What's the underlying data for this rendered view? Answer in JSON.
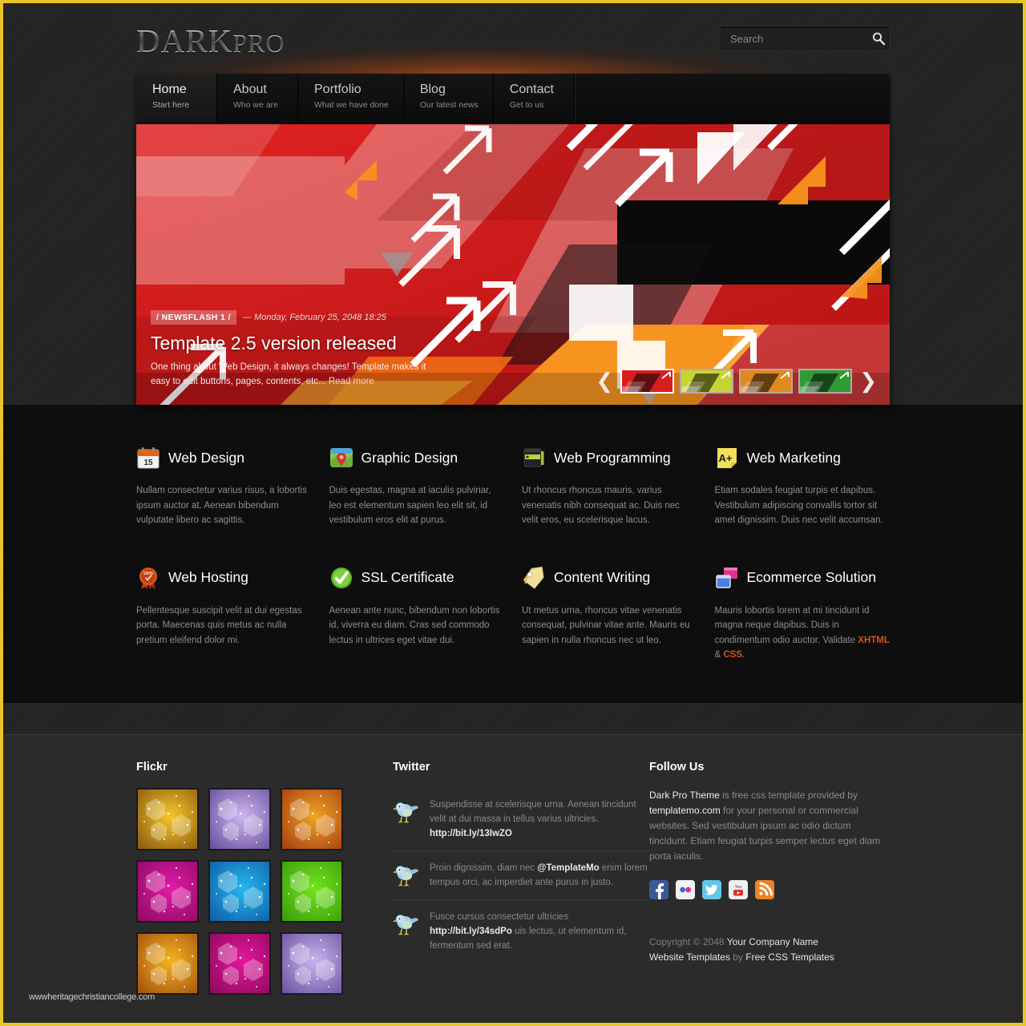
{
  "site": {
    "logo_dark": "DARK",
    "logo_pro": "PRO"
  },
  "search": {
    "placeholder": "Search",
    "value": "",
    "icon": "search-icon"
  },
  "nav": {
    "items": [
      {
        "label": "Home",
        "sub": "Start here",
        "active": true
      },
      {
        "label": "About",
        "sub": "Who we are",
        "active": false
      },
      {
        "label": "Portfolio",
        "sub": "What we have done",
        "active": false
      },
      {
        "label": "Blog",
        "sub": "Our latest news",
        "active": false
      },
      {
        "label": "Contact",
        "sub": "Get to us",
        "active": false
      }
    ]
  },
  "slider": {
    "badge": "/ NEWSFLASH 1 /",
    "date": "— Monday, February 25, 2048 18:25",
    "title": "Template 2.5 version released",
    "desc": "One thing about Web Design, it always changes! Template makes it easy to edit buttons, pages, contents, etc...",
    "read_more": "Read more",
    "prev_icon": "chevron-left-icon",
    "next_icon": "chevron-right-icon",
    "thumbs": [
      {
        "name": "thumb-red",
        "color": "#d81f1f",
        "active": true
      },
      {
        "name": "thumb-yellow",
        "color": "#c6d332",
        "active": false
      },
      {
        "name": "thumb-orange",
        "color": "#e08a1e",
        "active": false
      },
      {
        "name": "thumb-green",
        "color": "#2f9b34",
        "active": false
      }
    ]
  },
  "services": [
    {
      "title": "Web Design",
      "icon": "calendar-icon",
      "text": "Nullam consectetur varius risus, a lobortis ipsum auctor at. Aenean bibendum vulputate libero ac sagittis."
    },
    {
      "title": "Graphic Design",
      "icon": "map-pin-icon",
      "text": "Duis egestas, magna at iaculis pulvinar, leo est elementum sapien leo elit sit, id vestibulum eros elit at purus."
    },
    {
      "title": "Web Programming",
      "icon": "book-icon",
      "text": "Ut rhoncus rhoncus mauris, varius venenatis nibh consequat ac. Duis nec velit eros, eu scelerisque lacus."
    },
    {
      "title": "Web Marketing",
      "icon": "a-plus-note-icon",
      "text": "Etiam sodales feugiat turpis et dapibus. Vestibulum adipiscing convallis tortor sit amet dignissim. Duis nec velit accumsan."
    },
    {
      "title": "Web Hosting",
      "icon": "award-badge-icon",
      "text": "Pellentesque suscipit velit at dui egestas porta. Maecenas quis metus ac nulla pretium eleifend dolor mi."
    },
    {
      "title": "SSL Certificate",
      "icon": "check-circle-icon",
      "text": "Aenean ante nunc, bibendum non lobortis id, viverra eu diam. Cras sed commodo lectus in ultrices eget vitae dui."
    },
    {
      "title": "Content Writing",
      "icon": "tag-icon",
      "text": "Ut metus urna, rhoncus vitae venenatis consequat, pulvinar vitae ante. Mauris eu sapien in nulla rhoncus nec ut leo."
    },
    {
      "title": "Ecommerce Solution",
      "icon": "windows-icon",
      "text_before": "Mauris lobortis lorem at mi tincidunt id magna neque dapibus. Duis in condimentum odio auctor. Validate ",
      "link1": "XHTML",
      "text_mid": " & ",
      "link2": "CSS",
      "text_after": "."
    }
  ],
  "footer": {
    "flickr": {
      "heading": "Flickr",
      "images": [
        {
          "name": "flickr-gold",
          "c1": "#f7c62a",
          "c2": "#8a5c10"
        },
        {
          "name": "flickr-purple",
          "c1": "#cdb6f0",
          "c2": "#6a4f9c"
        },
        {
          "name": "flickr-orange",
          "c1": "#f0a424",
          "c2": "#a83f12"
        },
        {
          "name": "flickr-magenta",
          "c1": "#e41aa8",
          "c2": "#8e0b66"
        },
        {
          "name": "flickr-blue",
          "c1": "#26b8f0",
          "c2": "#0f5fa8"
        },
        {
          "name": "flickr-green",
          "c1": "#74e61c",
          "c2": "#3b9c0c"
        },
        {
          "name": "flickr-amber",
          "c1": "#f5b521",
          "c2": "#a3520f"
        },
        {
          "name": "flickr-pink",
          "c1": "#e6169c",
          "c2": "#8d0a5e"
        },
        {
          "name": "flickr-violet",
          "c1": "#c9b4ef",
          "c2": "#6d53a0"
        }
      ]
    },
    "twitter": {
      "heading": "Twitter",
      "posts": [
        {
          "before": "Suspendisse at scelerisque urna. Aenean tincidunt velit at dui massa in tellus varius ultricies. ",
          "link": "http://bit.ly/13IwZO",
          "after": ""
        },
        {
          "before": "Proin dignissim, diam nec ",
          "link": "@TemplateMo",
          "after": " enim lorem tempus orci, ac imperdiet ante purus in justo."
        },
        {
          "before": "Fusce cursus consectetur ultricies ",
          "link": "http://bit.ly/34sdPo",
          "after": " uis lectus, ut elementum id, fermentum sed erat."
        }
      ]
    },
    "follow": {
      "heading": "Follow Us",
      "link1": "Dark Pro Theme",
      "text1": " is free css template provided by ",
      "link2": "templatemo.com",
      "text2": " for your personal or commercial websites. Sed vestibulum ipsum ac odio dictum tincidunt. Etiam feugiat turpis semper lectus eget diam porta iaculis.",
      "socials": [
        {
          "name": "facebook-icon",
          "color": "#3b5998",
          "glyph": "f"
        },
        {
          "name": "flickr-icon",
          "color": "#f0f0f0",
          "glyph": "••"
        },
        {
          "name": "twitter-icon",
          "color": "#4fbbe0",
          "glyph": "t"
        },
        {
          "name": "youtube-icon",
          "color": "#e8e8e8",
          "glyph": "You"
        },
        {
          "name": "rss-icon",
          "color": "#ef8122",
          "glyph": "rss"
        }
      ]
    },
    "copyright": {
      "prefix": "Copyright © 2048 ",
      "company": "Your Company Name",
      "line2_link1": "Website Templates",
      "line2_mid": " by ",
      "line2_link2": "Free CSS Templates"
    },
    "watermark": "wwwheritagechristiancollege.com"
  },
  "colors": {
    "border": "#e8c52a",
    "accent": "#d4521f",
    "glow": "#ff7014"
  }
}
